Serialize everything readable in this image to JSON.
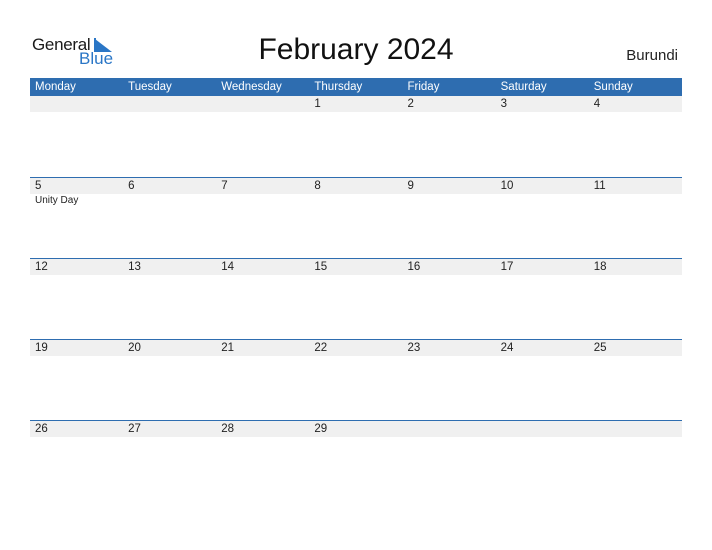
{
  "logo": {
    "line1": "General",
    "line2": "Blue",
    "accent": "#2a76c6"
  },
  "title": "February 2024",
  "country": "Burundi",
  "colors": {
    "header_bg": "#2e6db0",
    "day_bar_bg": "#f0f0f0"
  },
  "weekdays": [
    "Monday",
    "Tuesday",
    "Wednesday",
    "Thursday",
    "Friday",
    "Saturday",
    "Sunday"
  ],
  "weeks": [
    {
      "days": [
        "",
        "",
        "",
        "1",
        "2",
        "3",
        "4"
      ],
      "events": [
        "",
        "",
        "",
        "",
        "",
        "",
        ""
      ]
    },
    {
      "days": [
        "5",
        "6",
        "7",
        "8",
        "9",
        "10",
        "11"
      ],
      "events": [
        "Unity Day",
        "",
        "",
        "",
        "",
        "",
        ""
      ]
    },
    {
      "days": [
        "12",
        "13",
        "14",
        "15",
        "16",
        "17",
        "18"
      ],
      "events": [
        "",
        "",
        "",
        "",
        "",
        "",
        ""
      ]
    },
    {
      "days": [
        "19",
        "20",
        "21",
        "22",
        "23",
        "24",
        "25"
      ],
      "events": [
        "",
        "",
        "",
        "",
        "",
        "",
        ""
      ]
    },
    {
      "days": [
        "26",
        "27",
        "28",
        "29",
        "",
        "",
        ""
      ],
      "events": [
        "",
        "",
        "",
        "",
        "",
        "",
        ""
      ]
    }
  ]
}
